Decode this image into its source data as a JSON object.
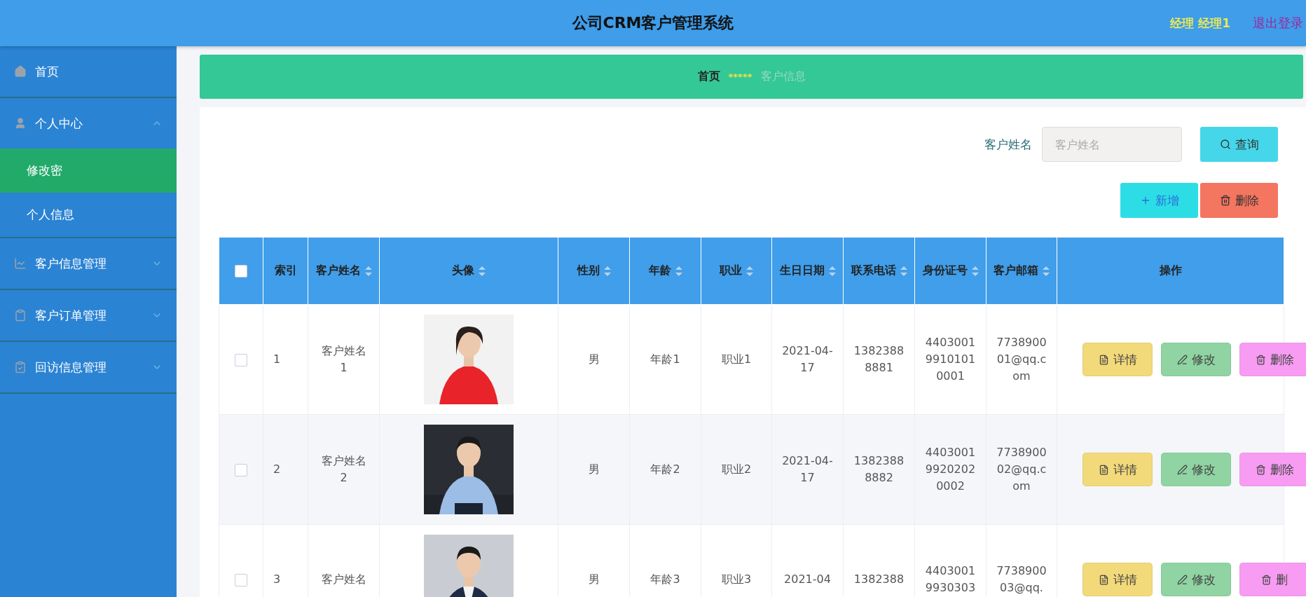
{
  "header": {
    "title": "公司CRM客户管理系统",
    "user": "经理 经理1",
    "logout": "退出登录"
  },
  "sidebar": {
    "items": [
      {
        "label": "首页",
        "selected": false
      },
      {
        "label": "个人中心",
        "selected": false,
        "expanded": true,
        "children": [
          {
            "label": "修改密",
            "selected": true
          },
          {
            "label": "个人信息",
            "selected": false
          }
        ]
      },
      {
        "label": "客户信息管理",
        "selected": false,
        "expanded": false
      },
      {
        "label": "客户订单管理",
        "selected": false,
        "expanded": false
      },
      {
        "label": "回访信息管理",
        "selected": false,
        "expanded": false
      }
    ]
  },
  "breadcrumb": {
    "items": [
      "首页",
      "客户信息"
    ],
    "separator": "*****"
  },
  "search": {
    "label": "客户姓名",
    "placeholder": "客户姓名",
    "button": "查询"
  },
  "actions": [
    {
      "kind": "add",
      "label": "新增"
    },
    {
      "kind": "delete",
      "label": "删除"
    }
  ],
  "table": {
    "select_all": {
      "checked": false
    },
    "columns": [
      {
        "label": "索引",
        "sortable": false
      },
      {
        "label": "客户姓名",
        "sortable": true
      },
      {
        "label": "头像",
        "sortable": true
      },
      {
        "label": "性别",
        "sortable": true
      },
      {
        "label": "年龄",
        "sortable": true
      },
      {
        "label": "职业",
        "sortable": true
      },
      {
        "label": "生日日期",
        "sortable": true
      },
      {
        "label": "联系电话",
        "sortable": true
      },
      {
        "label": "身份证号",
        "sortable": true
      },
      {
        "label": "客户邮箱",
        "sortable": true
      },
      {
        "label": "操作",
        "sortable": false
      }
    ],
    "rows": [
      {
        "checked": false,
        "index": "1",
        "name": "客户姓名1",
        "gender": "男",
        "age": "年龄1",
        "job": "职业1",
        "birthday": "2021-04-17",
        "phone": "13823888881",
        "id_number": "440300199101010001",
        "email": "773890001@qq.com",
        "buttons": [
          {
            "kind": "detail",
            "label": "详情"
          },
          {
            "kind": "edit",
            "label": "修改"
          },
          {
            "kind": "delete",
            "label": "删除"
          }
        ]
      },
      {
        "checked": false,
        "index": "2",
        "name": "客户姓名2",
        "gender": "男",
        "age": "年龄2",
        "job": "职业2",
        "birthday": "2021-04-17",
        "phone": "13823888882",
        "id_number": "440300199202020002",
        "email": "773890002@qq.com",
        "buttons": [
          {
            "kind": "detail",
            "label": "详情"
          },
          {
            "kind": "edit",
            "label": "修改"
          },
          {
            "kind": "delete",
            "label": "删除"
          }
        ]
      },
      {
        "checked": false,
        "index": "3",
        "name": "客户姓名",
        "gender": "男",
        "age": "年龄3",
        "job": "职业3",
        "birthday": "2021-04",
        "phone": "1382388",
        "id_number": "44030019930303",
        "email": "773890003@qq.",
        "buttons": [
          {
            "kind": "detail",
            "label": "详情"
          },
          {
            "kind": "edit",
            "label": "修改"
          },
          {
            "kind": "delete",
            "label": "删"
          }
        ]
      }
    ]
  }
}
